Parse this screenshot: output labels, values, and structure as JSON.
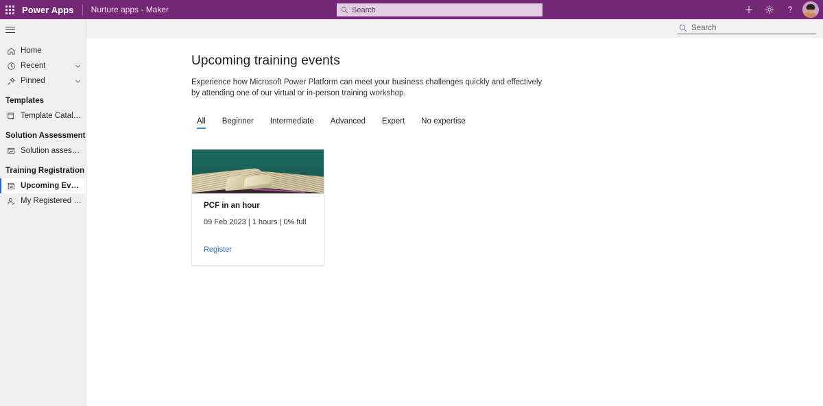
{
  "header": {
    "waffle_label": "app-launcher",
    "brand": "Power Apps",
    "environment": "Nurture apps - Maker",
    "search_placeholder": "Search",
    "actions": [
      {
        "name": "new-button",
        "glyph": "+"
      },
      {
        "name": "settings-button",
        "glyph": "gear"
      },
      {
        "name": "help-button",
        "glyph": "?"
      }
    ],
    "avatar_alt": "User avatar",
    "bar_color": "#742774",
    "search_bg": "#e3cfe3"
  },
  "sidebar": {
    "menu_toggle_label": "Show/Hide navigation",
    "items": [
      {
        "label": "Home",
        "icon": "home-icon",
        "expandable": false,
        "selected": false
      },
      {
        "label": "Recent",
        "icon": "clock-icon",
        "expandable": true,
        "selected": false
      },
      {
        "label": "Pinned",
        "icon": "pin-icon",
        "expandable": true,
        "selected": false
      }
    ],
    "groups": [
      {
        "title": "Templates",
        "items": [
          {
            "label": "Template Catalog",
            "icon": "template-catalog-icon",
            "selected": false
          }
        ]
      },
      {
        "title": "Solution Assessment",
        "items": [
          {
            "label": "Solution assessment",
            "icon": "solution-assessment-icon",
            "selected": false
          }
        ]
      },
      {
        "title": "Training Registration",
        "items": [
          {
            "label": "Upcoming Events",
            "icon": "upcoming-events-icon",
            "selected": true
          },
          {
            "label": "My Registered Events",
            "icon": "registered-events-icon",
            "selected": false
          }
        ]
      }
    ],
    "selected_indicator_color": "#2266cc",
    "background": "#f0f0f0"
  },
  "commandbar": {
    "search_placeholder": "Search"
  },
  "main": {
    "title": "Upcoming training events",
    "description": "Experience how Microsoft Power Platform can meet your business challenges quickly and effectively by attending one of our virtual or in-person training workshop.",
    "tabs": [
      {
        "label": "All",
        "active": true
      },
      {
        "label": "Beginner",
        "active": false
      },
      {
        "label": "Intermediate",
        "active": false
      },
      {
        "label": "Advanced",
        "active": false
      },
      {
        "label": "Expert",
        "active": false
      },
      {
        "label": "No expertise",
        "active": false
      }
    ],
    "tab_accent_color": "#2a87d0",
    "cards": [
      {
        "image_alt": "open book on teal background",
        "title": "PCF in an hour",
        "meta": "09 Feb 2023 | 1 hours | 0% full",
        "link_label": "Register",
        "link_color": "#2a6fc9"
      }
    ]
  }
}
